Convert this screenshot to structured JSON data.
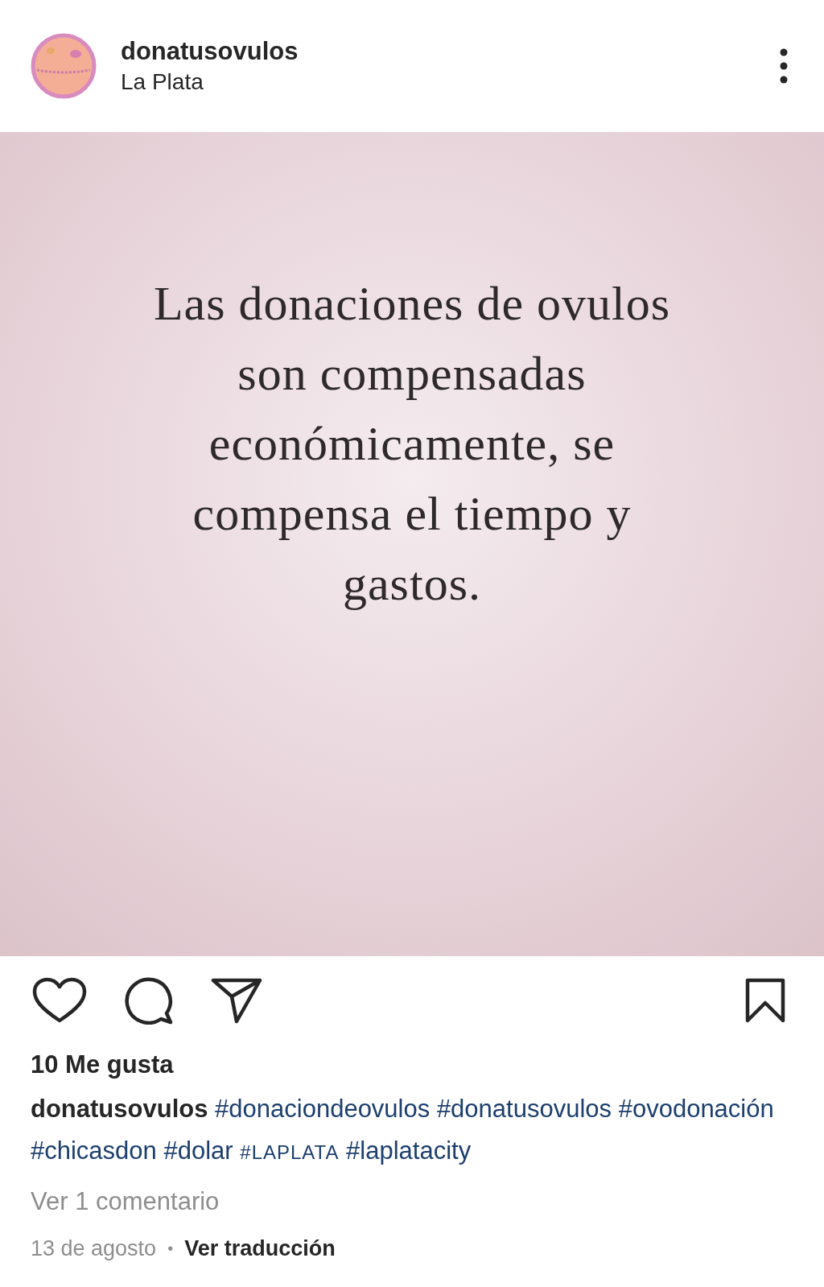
{
  "post": {
    "account": {
      "username": "donatusovulos",
      "location": "La Plata"
    },
    "image_text_lines": [
      "Las donaciones de ovulos",
      "son compensadas",
      "económicamente, se",
      "compensa el tiempo y",
      "gastos."
    ],
    "likes": "10 Me gusta",
    "caption": {
      "username": "donatusovulos",
      "hashtags": [
        {
          "text": "#donaciondeovulos",
          "kind": "normal"
        },
        {
          "text": "#donatusovulos",
          "kind": "normal"
        },
        {
          "text": "#ovodonación",
          "kind": "normal"
        },
        {
          "text": "#chicasdon",
          "kind": "normal"
        },
        {
          "text": "#dolar",
          "kind": "normal"
        },
        {
          "text": "#LAPLATA",
          "kind": "small"
        },
        {
          "text": "#laplatacity",
          "kind": "normal"
        }
      ]
    },
    "comments_link": "Ver 1 comentario",
    "date": "13 de agosto",
    "separator": "•",
    "translate_link": "Ver traducción"
  }
}
